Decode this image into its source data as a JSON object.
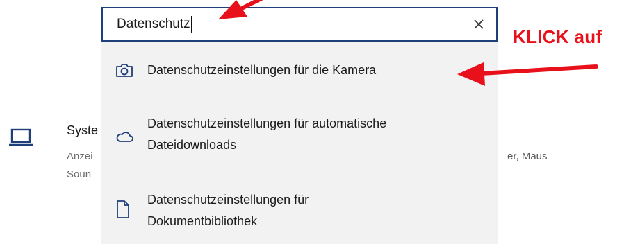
{
  "search": {
    "value": "Datenschutz",
    "clear_icon": "close-icon"
  },
  "results": [
    {
      "icon": "camera-icon",
      "line1": "Datenschutzeinstellungen für die Kamera",
      "line2": ""
    },
    {
      "icon": "cloud-icon",
      "line1": "Datenschutzeinstellungen für automatische",
      "line2": "Dateidownloads"
    },
    {
      "icon": "document-icon",
      "line1": "Datenschutzeinstellungen für",
      "line2": "Dokumentbibliothek"
    }
  ],
  "background_tile": {
    "icon": "laptop-icon",
    "title_partial": "Syste",
    "desc_line1_partial": "Anzei",
    "desc_line2_partial": "Soun",
    "desc_right_partial": "er, Maus"
  },
  "annotation": {
    "text": "KLICK auf",
    "color": "#e8101a"
  },
  "colors": {
    "search_border": "#1f3f7a",
    "dropdown_bg": "#f2f2f2",
    "icon_blue": "#1f3f7a"
  }
}
